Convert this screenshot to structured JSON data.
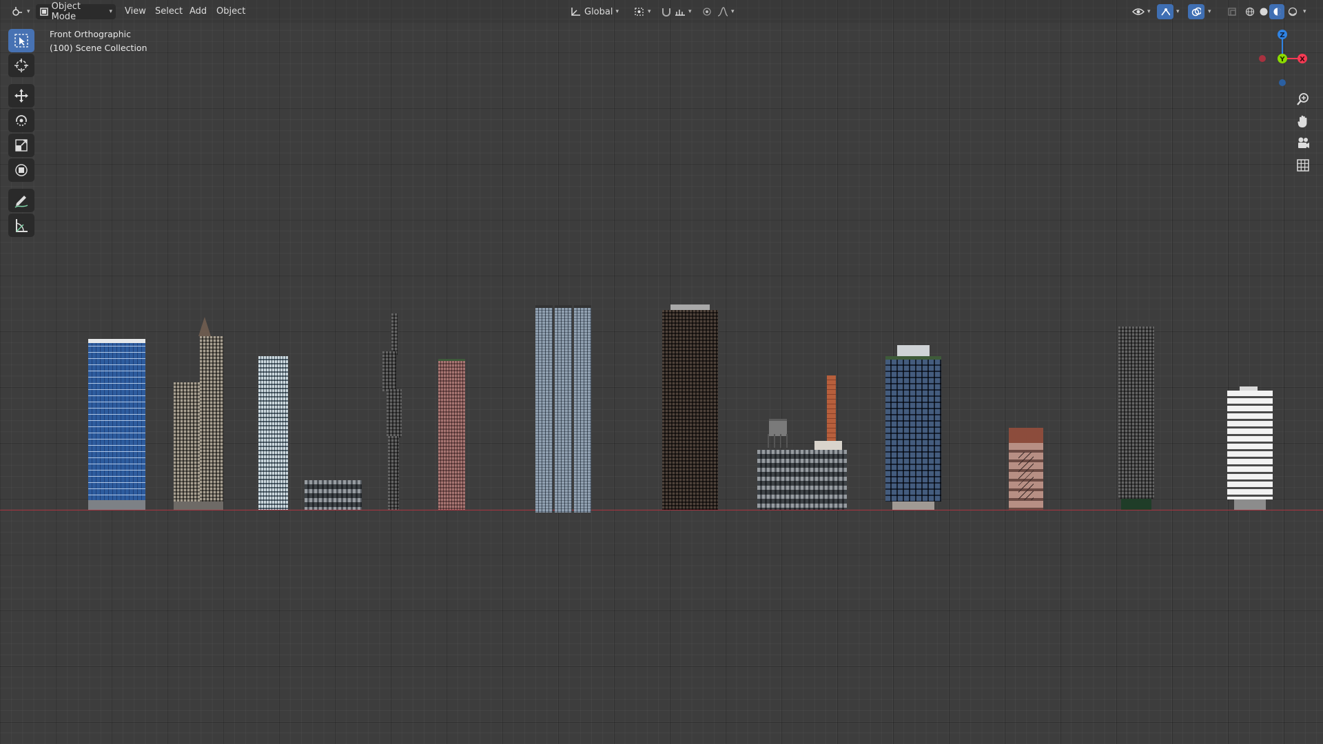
{
  "header": {
    "mode_label": "Object Mode",
    "menus": [
      "View",
      "Select",
      "Add",
      "Object"
    ],
    "orientation_label": "Global"
  },
  "viewport_info": {
    "view_name": "Front Orthographic",
    "collection": "(100) Scene Collection"
  },
  "gizmo": {
    "z_label": "Z",
    "y_label": "Y",
    "x_label": "X",
    "z_color": "#2f83e3",
    "y_color": "#8bdc00",
    "x_color": "#f53a54"
  },
  "icons": {
    "left_tools": [
      "select-box-icon",
      "cursor-icon",
      "move-icon",
      "rotate-icon",
      "scale-icon",
      "transform-icon",
      "annotate-icon",
      "measure-icon"
    ],
    "right_nav": [
      "zoom-icon",
      "pan-hand-icon",
      "camera-icon",
      "grid-icon"
    ]
  },
  "colors": {
    "background": "#3d3d3d",
    "accent": "#4772b3",
    "ground_line": "#a83440"
  }
}
